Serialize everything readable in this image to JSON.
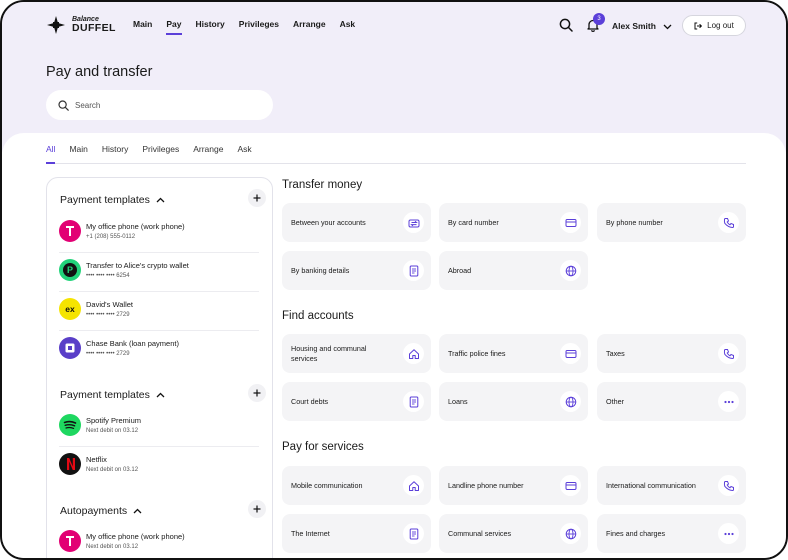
{
  "brand": {
    "top": "Balance",
    "name": "DUFFEL"
  },
  "nav": [
    "Main",
    "Pay",
    "History",
    "Privileges",
    "Arrange",
    "Ask"
  ],
  "nav_active": "Pay",
  "notifications": {
    "count": "3"
  },
  "user": {
    "name": "Alex Smith"
  },
  "logout_label": "Log out",
  "page_title": "Pay and transfer",
  "search": {
    "placeholder": "Search"
  },
  "tabs": [
    "All",
    "Main",
    "History",
    "Privileges",
    "Arrange",
    "Ask"
  ],
  "active_tab": "All",
  "sidebar": {
    "sections": [
      {
        "title": "Payment templates",
        "items": [
          {
            "name": "My office phone (work phone)",
            "sub": "+1 (208) 555-0112",
            "icon": "t-mobile-logo"
          },
          {
            "name": "Transfer to Alice's crypto wallet",
            "sub": "•••• •••• •••• 6254",
            "icon": "crypto-logo"
          },
          {
            "name": "David's Wallet",
            "sub": "•••• •••• •••• 2729",
            "icon": "exchange-logo"
          },
          {
            "name": "Chase Bank (loan payment)",
            "sub": "•••• •••• •••• 2729",
            "icon": "chase-logo"
          }
        ]
      },
      {
        "title": "Payment templates",
        "items": [
          {
            "name": "Spotify Premium",
            "sub": "Next debit on 03.12",
            "icon": "spotify-logo"
          },
          {
            "name": "Netflix",
            "sub": "Next debit on 03.12",
            "icon": "netflix-logo"
          }
        ]
      },
      {
        "title": "Autopayments",
        "items": [
          {
            "name": "My office phone (work phone)",
            "sub": "Next debit on 03.12",
            "icon": "t-mobile-logo"
          }
        ]
      }
    ]
  },
  "groups": [
    {
      "title": "Transfer money",
      "cards": [
        {
          "label": "Between your accounts",
          "icon": "transfer-icon"
        },
        {
          "label": "By card number",
          "icon": "card-icon"
        },
        {
          "label": "By phone number",
          "icon": "phone-icon"
        },
        {
          "label": "By banking details",
          "icon": "document-icon"
        },
        {
          "label": "Abroad",
          "icon": "globe-icon"
        }
      ]
    },
    {
      "title": "Find accounts",
      "cards": [
        {
          "label": "Housing and communal services",
          "icon": "home-icon"
        },
        {
          "label": "Traffic police fines",
          "icon": "card-icon"
        },
        {
          "label": "Taxes",
          "icon": "phone-icon"
        },
        {
          "label": "Court debts",
          "icon": "document-icon"
        },
        {
          "label": "Loans",
          "icon": "globe-icon"
        },
        {
          "label": "Other",
          "icon": "more-icon"
        }
      ]
    },
    {
      "title": "Pay for services",
      "cards": [
        {
          "label": "Mobile communication",
          "icon": "home-icon"
        },
        {
          "label": "Landline phone number",
          "icon": "card-icon"
        },
        {
          "label": "International communication",
          "icon": "phone-icon"
        },
        {
          "label": "The Internet",
          "icon": "document-icon"
        },
        {
          "label": "Communal services",
          "icon": "globe-icon"
        },
        {
          "label": "Fines and charges",
          "icon": "more-icon"
        }
      ]
    }
  ],
  "colors": {
    "accent": "#5b3fd9",
    "hero_bg": "#f1eef9",
    "card_bg": "#f4f4f6"
  }
}
